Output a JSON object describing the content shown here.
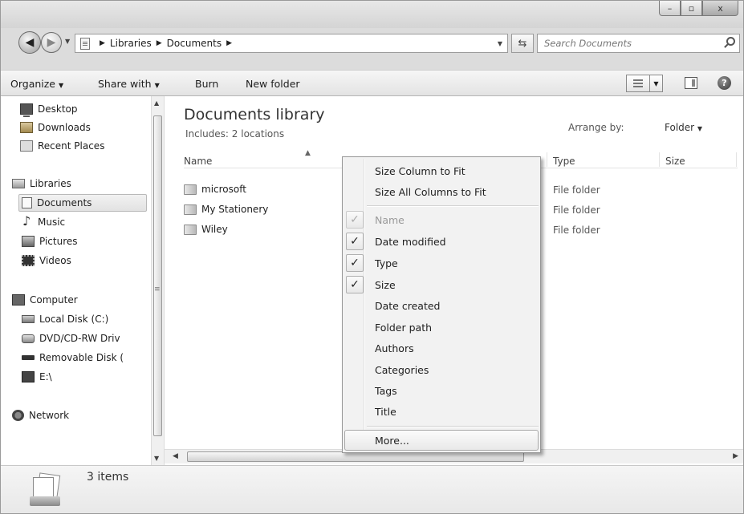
{
  "window": {
    "controls": {
      "minimize": "–",
      "maximize": "▫",
      "close": "x"
    }
  },
  "address": {
    "crumbs": [
      "Libraries",
      "Documents"
    ],
    "search_placeholder": "Search Documents"
  },
  "toolbar": {
    "organize": "Organize",
    "share_with": "Share with",
    "burn": "Burn",
    "new_folder": "New folder"
  },
  "nav": {
    "favorites": [
      "Desktop",
      "Downloads",
      "Recent Places"
    ],
    "libraries_label": "Libraries",
    "libraries": [
      "Documents",
      "Music",
      "Pictures",
      "Videos"
    ],
    "computer_label": "Computer",
    "drives": [
      "Local Disk (C:)",
      "DVD/CD-RW Driv",
      "Removable Disk (",
      "E:\\"
    ],
    "network_label": "Network",
    "selected": "Documents"
  },
  "content": {
    "title": "Documents library",
    "includes_prefix": "Includes: ",
    "includes_link": "2 locations",
    "arrange_label": "Arrange by:",
    "arrange_value": "Folder",
    "columns": [
      "Name",
      "Type",
      "Size"
    ],
    "files": [
      {
        "name": "microsoft",
        "type": "File folder"
      },
      {
        "name": "My Stationery",
        "type": "File folder"
      },
      {
        "name": "Wiley",
        "type": "File folder"
      }
    ]
  },
  "context_menu": {
    "top_items": [
      "Size Column to Fit",
      "Size All Columns to Fit"
    ],
    "column_items": [
      {
        "label": "Name",
        "checked": true,
        "disabled": true
      },
      {
        "label": "Date modified",
        "checked": true,
        "disabled": false
      },
      {
        "label": "Type",
        "checked": true,
        "disabled": false
      },
      {
        "label": "Size",
        "checked": true,
        "disabled": false
      },
      {
        "label": "Date created",
        "checked": false,
        "disabled": false
      },
      {
        "label": "Folder path",
        "checked": false,
        "disabled": false
      },
      {
        "label": "Authors",
        "checked": false,
        "disabled": false
      },
      {
        "label": "Categories",
        "checked": false,
        "disabled": false
      },
      {
        "label": "Tags",
        "checked": false,
        "disabled": false
      },
      {
        "label": "Title",
        "checked": false,
        "disabled": false
      }
    ],
    "more": "More...",
    "check_glyph": "✓"
  },
  "details": {
    "count": "3 items"
  }
}
